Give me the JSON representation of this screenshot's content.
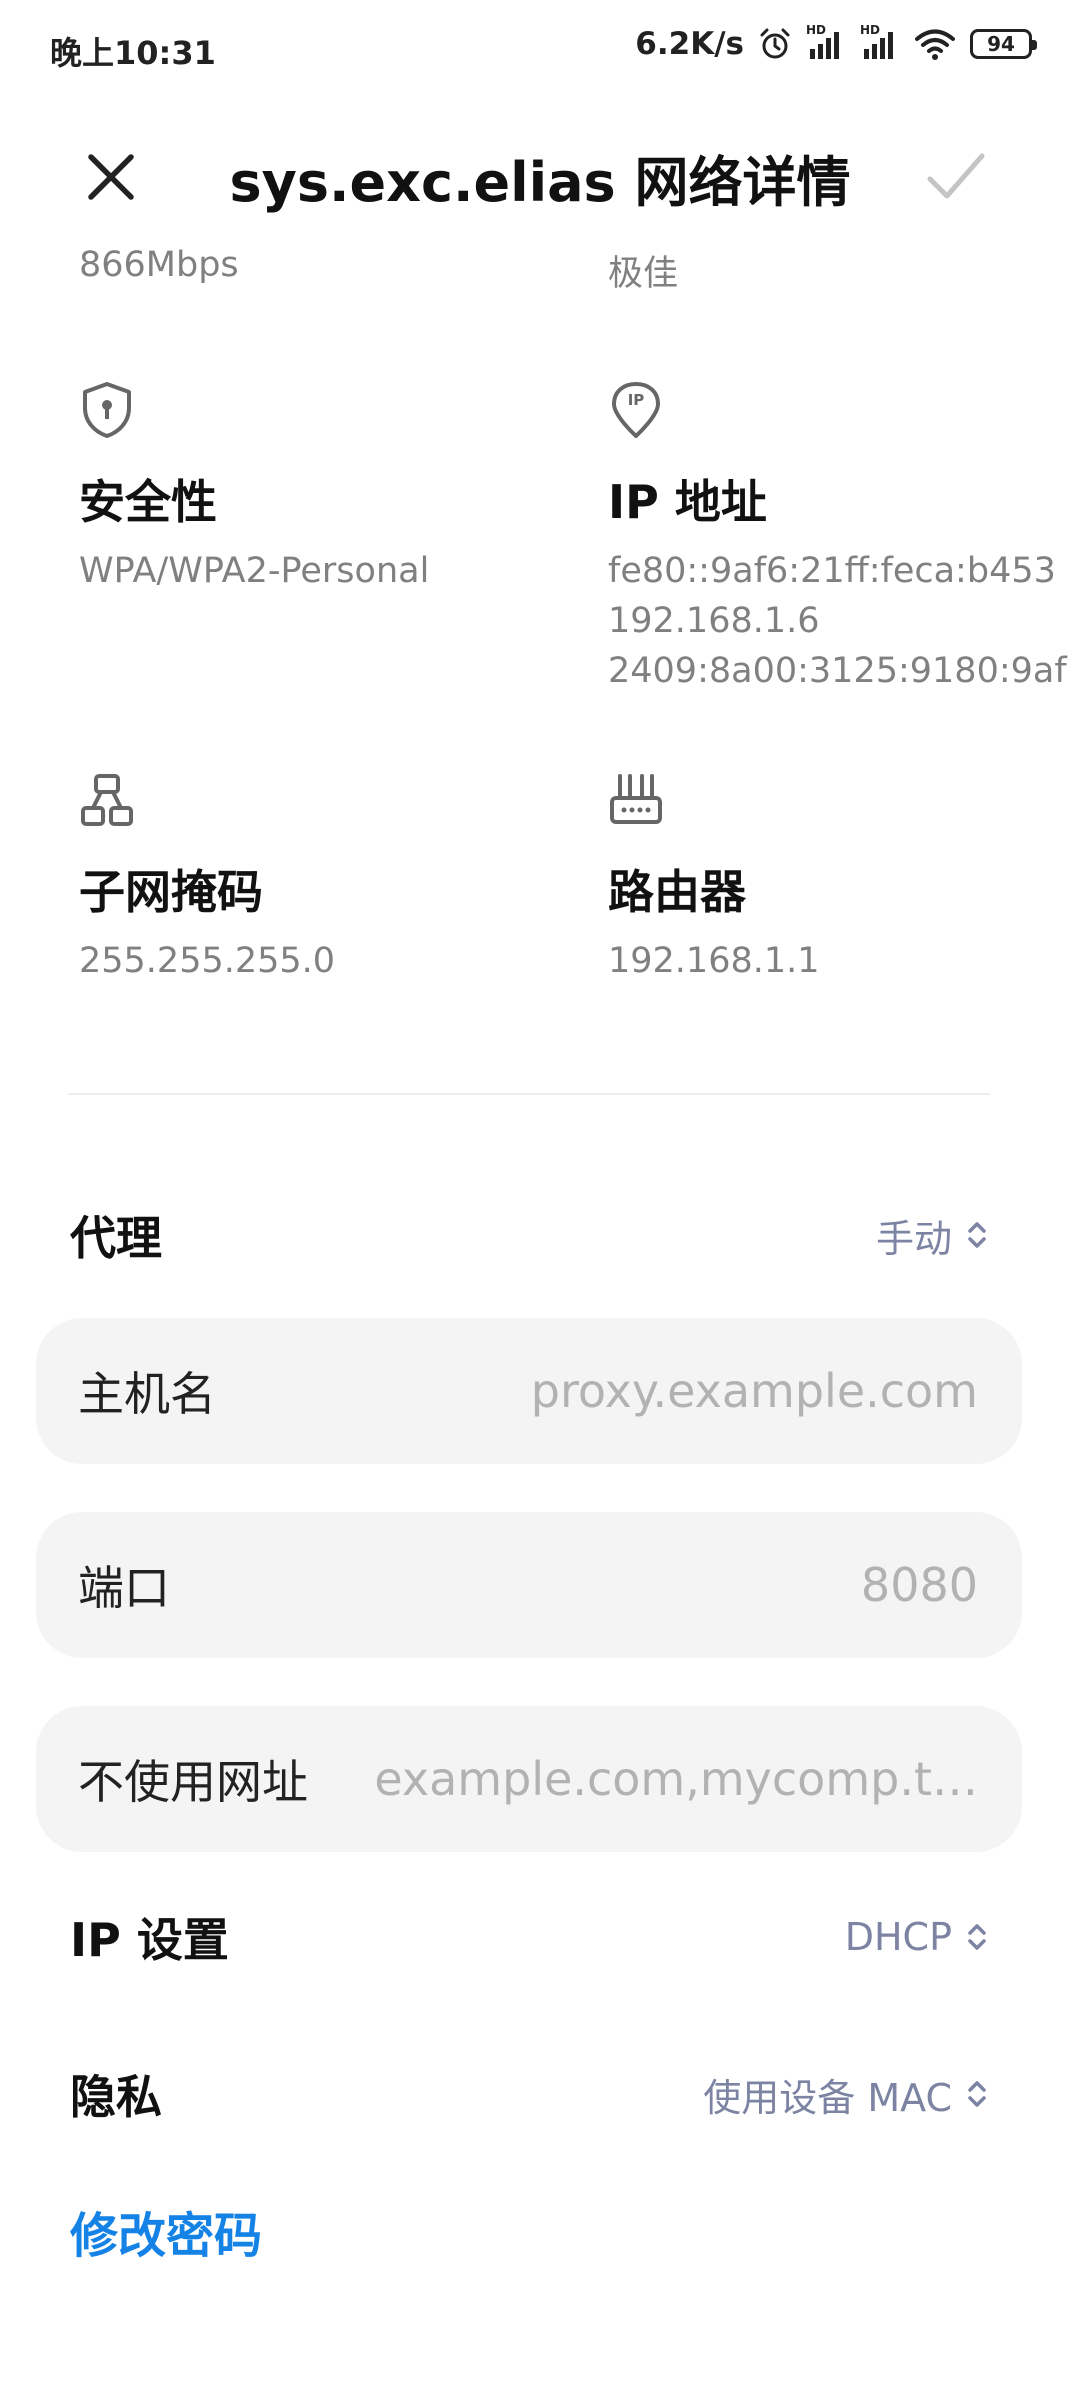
{
  "status_bar": {
    "time": "晚上10:31",
    "net_speed": "6.2K/s",
    "battery": "94",
    "signal_label_1": "HD",
    "signal_label_2": "HD"
  },
  "header": {
    "title": "sys.exc.elias 网络详情"
  },
  "details": {
    "speed_value": "866Mbps",
    "quality_value": "极佳",
    "security": {
      "label": "安全性",
      "value": "WPA/WPA2-Personal"
    },
    "ip": {
      "icon_text": "IP",
      "label": "IP 地址",
      "values": [
        "fe80::9af6:21ff:feca:b453",
        "192.168.1.6",
        "2409:8a00:3125:9180:9af"
      ]
    },
    "subnet": {
      "label": "子网掩码",
      "value": "255.255.255.0"
    },
    "router": {
      "label": "路由器",
      "value": "192.168.1.1"
    }
  },
  "proxy": {
    "label": "代理",
    "value": "手动",
    "hostname": {
      "label": "主机名",
      "placeholder": "proxy.example.com"
    },
    "port": {
      "label": "端口",
      "placeholder": "8080"
    },
    "bypass": {
      "label": "不使用网址",
      "placeholder": "example.com,mycomp.t…"
    }
  },
  "ip_settings": {
    "label": "IP 设置",
    "value": "DHCP"
  },
  "privacy": {
    "label": "隐私",
    "value": "使用设备 MAC"
  },
  "change_password": "修改密码",
  "colors": {
    "accent": "#1583e6",
    "value_gray": "#808080",
    "selector_text": "#7d84a3",
    "card_bg": "#f4f4f4"
  }
}
